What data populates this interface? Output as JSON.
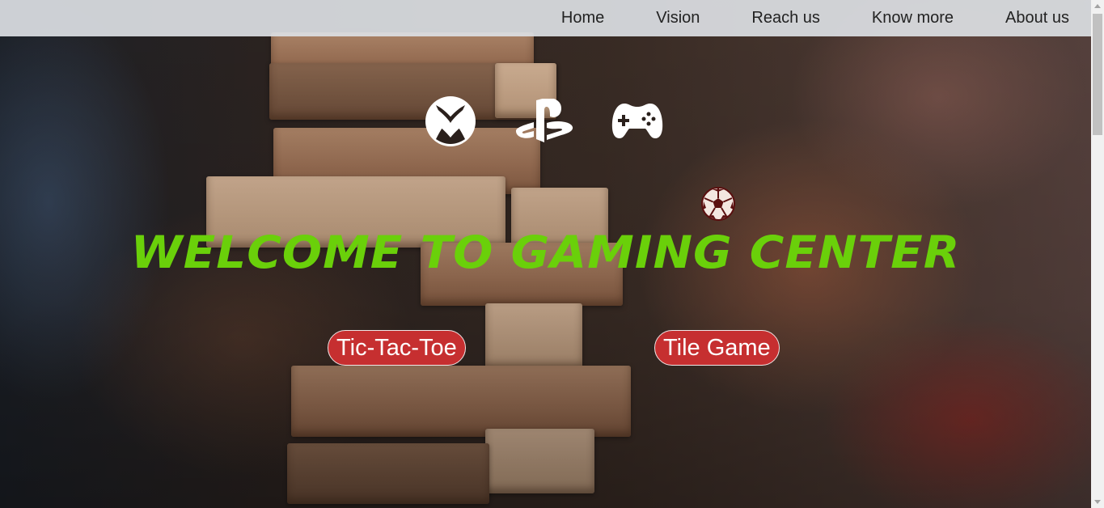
{
  "nav": {
    "items": [
      {
        "label": "Home"
      },
      {
        "label": "Vision"
      },
      {
        "label": "Reach us"
      },
      {
        "label": "Know more"
      },
      {
        "label": "About us"
      }
    ]
  },
  "icons": [
    {
      "name": "xbox-icon",
      "color": "#ffffff"
    },
    {
      "name": "playstation-icon",
      "color": "#ffffff"
    },
    {
      "name": "gamepad-icon",
      "color": "#ffffff"
    },
    {
      "name": "soccer-ball-icon",
      "color": "#5a0f0f"
    }
  ],
  "hero": {
    "title": "WELCOME TO GAMING CENTER",
    "title_color": "#6ad00a"
  },
  "buttons": {
    "tictactoe": "Tic-Tac-Toe",
    "tile": "Tile Game",
    "button_color": "#c62f30"
  }
}
